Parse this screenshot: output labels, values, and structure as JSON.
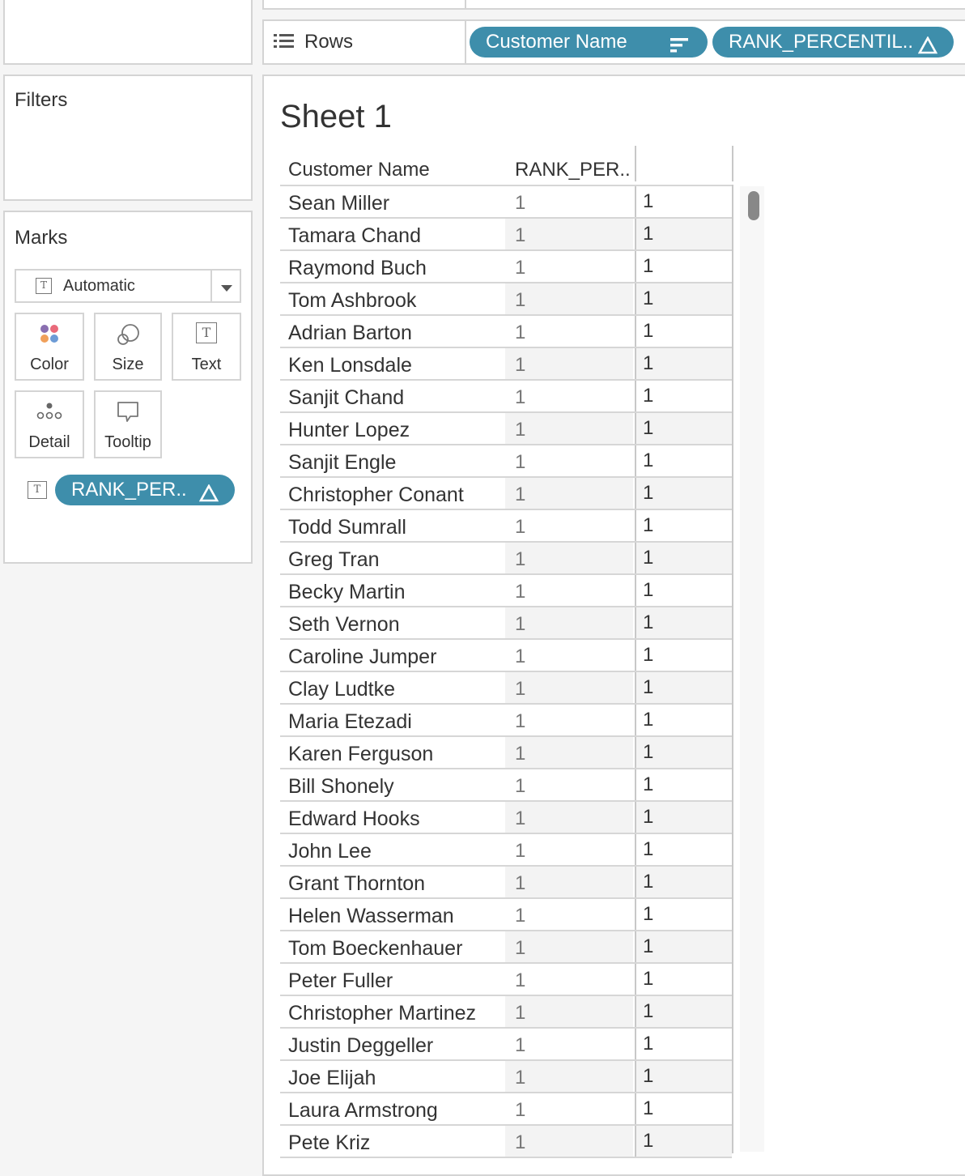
{
  "shelves": {
    "rows_label": "Rows",
    "rows_pills": [
      {
        "label": "Customer Name",
        "icon": "sort-descending-icon"
      },
      {
        "label": "RANK_PERCENTIL..",
        "icon": "delta-icon"
      }
    ]
  },
  "filters": {
    "title": "Filters"
  },
  "marks": {
    "title": "Marks",
    "mark_type": "Automatic",
    "buttons": [
      "Color",
      "Size",
      "Text",
      "Detail",
      "Tooltip"
    ],
    "text_pill": "RANK_PER.."
  },
  "sheet": {
    "title": "Sheet 1",
    "headers": [
      "Customer Name",
      "RANK_PER.."
    ],
    "rows": [
      {
        "name": "Sean Miller",
        "rank": "1",
        "val": "1"
      },
      {
        "name": "Tamara Chand",
        "rank": "1",
        "val": "1"
      },
      {
        "name": "Raymond Buch",
        "rank": "1",
        "val": "1"
      },
      {
        "name": "Tom Ashbrook",
        "rank": "1",
        "val": "1"
      },
      {
        "name": "Adrian Barton",
        "rank": "1",
        "val": "1"
      },
      {
        "name": "Ken Lonsdale",
        "rank": "1",
        "val": "1"
      },
      {
        "name": "Sanjit Chand",
        "rank": "1",
        "val": "1"
      },
      {
        "name": "Hunter Lopez",
        "rank": "1",
        "val": "1"
      },
      {
        "name": "Sanjit Engle",
        "rank": "1",
        "val": "1"
      },
      {
        "name": "Christopher Conant",
        "rank": "1",
        "val": "1"
      },
      {
        "name": "Todd Sumrall",
        "rank": "1",
        "val": "1"
      },
      {
        "name": "Greg Tran",
        "rank": "1",
        "val": "1"
      },
      {
        "name": "Becky Martin",
        "rank": "1",
        "val": "1"
      },
      {
        "name": "Seth Vernon",
        "rank": "1",
        "val": "1"
      },
      {
        "name": "Caroline Jumper",
        "rank": "1",
        "val": "1"
      },
      {
        "name": "Clay Ludtke",
        "rank": "1",
        "val": "1"
      },
      {
        "name": "Maria Etezadi",
        "rank": "1",
        "val": "1"
      },
      {
        "name": "Karen Ferguson",
        "rank": "1",
        "val": "1"
      },
      {
        "name": "Bill Shonely",
        "rank": "1",
        "val": "1"
      },
      {
        "name": "Edward Hooks",
        "rank": "1",
        "val": "1"
      },
      {
        "name": "John Lee",
        "rank": "1",
        "val": "1"
      },
      {
        "name": "Grant Thornton",
        "rank": "1",
        "val": "1"
      },
      {
        "name": "Helen Wasserman",
        "rank": "1",
        "val": "1"
      },
      {
        "name": "Tom Boeckenhauer",
        "rank": "1",
        "val": "1"
      },
      {
        "name": "Peter Fuller",
        "rank": "1",
        "val": "1"
      },
      {
        "name": "Christopher Martinez",
        "rank": "1",
        "val": "1"
      },
      {
        "name": "Justin Deggeller",
        "rank": "1",
        "val": "1"
      },
      {
        "name": "Joe Elijah",
        "rank": "1",
        "val": "1"
      },
      {
        "name": "Laura Armstrong",
        "rank": "1",
        "val": "1"
      },
      {
        "name": "Pete Kriz",
        "rank": "1",
        "val": "1"
      }
    ]
  }
}
